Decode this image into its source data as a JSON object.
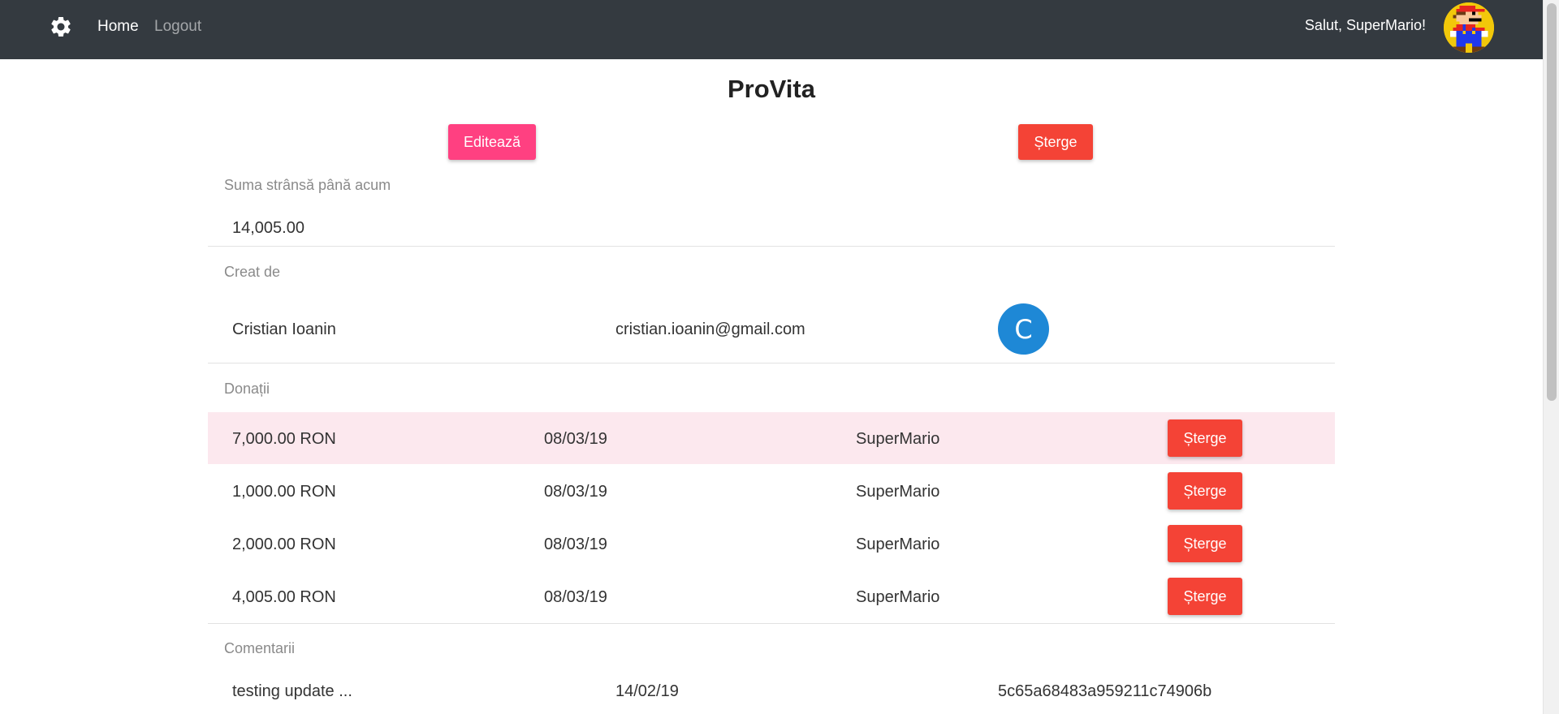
{
  "navbar": {
    "settings_icon": "gear-icon",
    "home_label": "Home",
    "logout_label": "Logout",
    "greeting": "Salut, SuperMario!"
  },
  "campaign": {
    "title": "ProVita",
    "edit_label": "Editează",
    "delete_label": "Șterge"
  },
  "amount": {
    "label": "Suma strânsă până acum",
    "value": "14,005.00"
  },
  "creator": {
    "label": "Creat de",
    "name": "Cristian Ioanin",
    "email": "cristian.ioanin@gmail.com",
    "avatar_letter": "C",
    "avatar_color": "#1e88d6"
  },
  "donations": {
    "label": "Donații",
    "delete_label": "Șterge",
    "rows": [
      {
        "amount": "7,000.00 RON",
        "date": "08/03/19",
        "user": "SuperMario"
      },
      {
        "amount": "1,000.00 RON",
        "date": "08/03/19",
        "user": "SuperMario"
      },
      {
        "amount": "2,000.00 RON",
        "date": "08/03/19",
        "user": "SuperMario"
      },
      {
        "amount": "4,005.00 RON",
        "date": "08/03/19",
        "user": "SuperMario"
      }
    ]
  },
  "comments": {
    "label": "Comentarii",
    "rows": [
      {
        "text": "testing update ...",
        "date": "14/02/19",
        "id": "5c65a68483a959211c74906b"
      }
    ]
  },
  "colors": {
    "navbar": "#343a40",
    "accent_pink": "#ff4081",
    "danger_red": "#f44336",
    "highlight_row": "#fce8ee"
  }
}
